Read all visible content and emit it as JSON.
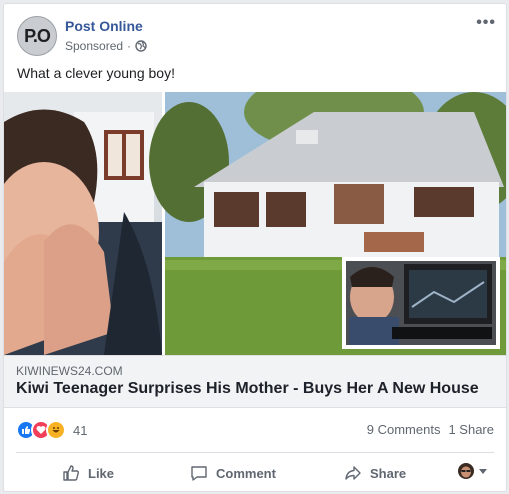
{
  "post": {
    "page_name": "Post Online",
    "avatar_initials": "P.O",
    "sponsored": "Sponsored",
    "separator": "·",
    "text": "What a clever young boy!"
  },
  "link": {
    "domain": "KIWINEWS24.COM",
    "headline": "Kiwi Teenager Surprises His Mother - Buys Her A New House"
  },
  "engagement": {
    "reaction_count": "41",
    "comments": "9 Comments",
    "shares": "1 Share",
    "reaction_icons": [
      "like-icon",
      "love-icon",
      "haha-icon"
    ]
  },
  "actions": {
    "like": "Like",
    "comment": "Comment",
    "share": "Share"
  },
  "colors": {
    "link_blue": "#365899",
    "like_blue": "#1877f2",
    "love_red": "#f33e58",
    "haha_yellow": "#f7b125"
  }
}
